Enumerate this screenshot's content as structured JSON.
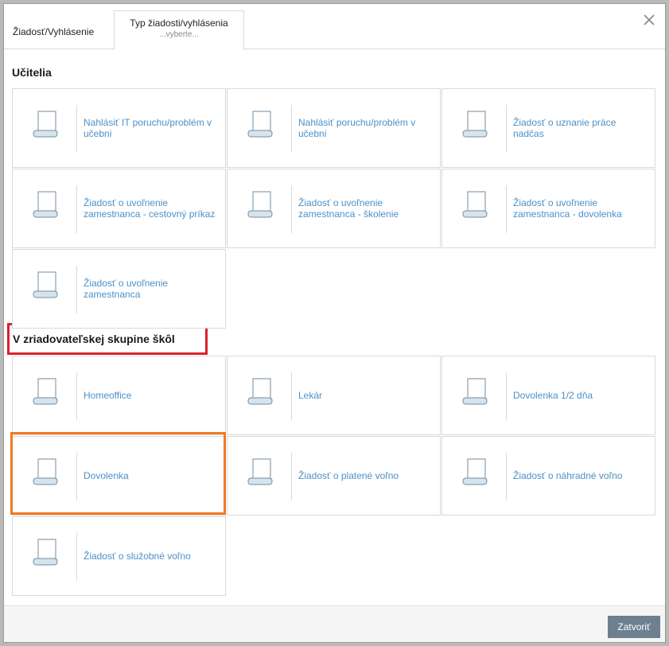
{
  "header": {
    "tab_first_label": "Žiadosť/Vyhlásenie",
    "tab_active_title": "Typ žiadosti/vyhlásenia",
    "tab_active_sub": "...vyberte..."
  },
  "sections": [
    {
      "title": "Učitelia",
      "items": [
        "Nahlásiť IT poruchu/problém v učebni",
        "Nahlásiť poruchu/problém v učebni",
        "Žiadosť o uznanie práce nadčas",
        "Žiadosť o uvoľnenie zamestnanca - cestovný príkaz",
        "Žiadosť o uvoľnenie zamestnanca - školenie",
        "Žiadosť o uvoľnenie zamestnanca - dovolenka",
        "Žiadosť o uvoľnenie zamestnanca"
      ]
    },
    {
      "title": "V zriadovateľskej skupine škôl",
      "items": [
        "Homeoffice",
        "Lekár",
        "Dovolenka 1/2 dňa",
        "Dovolenka",
        "Žiadosť o platené voľno",
        "Žiadosť o náhradné voľno",
        "Žiadosť o služobné voľno"
      ]
    }
  ],
  "footer": {
    "close_label": "Zatvoriť"
  },
  "colors": {
    "link": "#4d90c6",
    "highlight_section": "#d9232a",
    "highlight_item": "#f07a22",
    "button": "#6d8090"
  },
  "icons": {
    "close": "close-icon",
    "item": "document-scroll-icon"
  }
}
